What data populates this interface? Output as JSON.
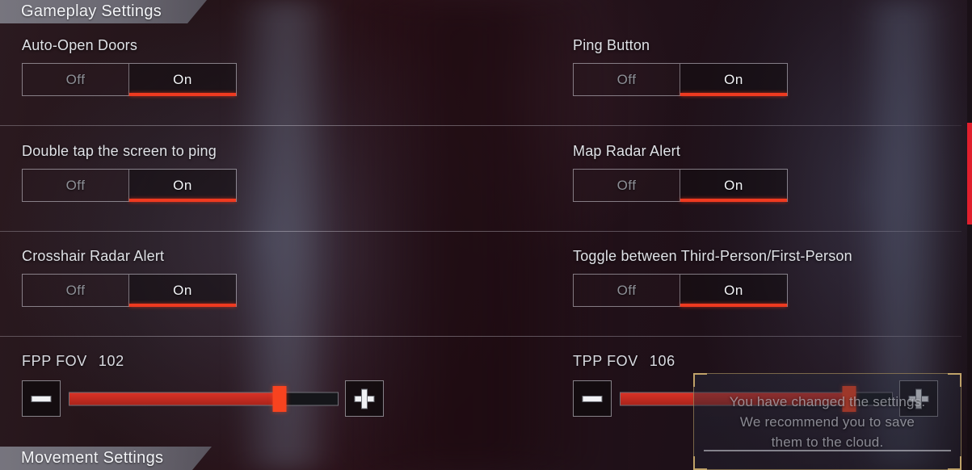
{
  "sections": {
    "gameplay": "Gameplay Settings",
    "movement": "Movement Settings"
  },
  "toggle_options": {
    "off": "Off",
    "on": "On"
  },
  "settings": [
    {
      "label": "Auto-Open Doors",
      "value": "On",
      "column": "left",
      "row": 1
    },
    {
      "label": "Ping Button",
      "value": "On",
      "column": "right",
      "row": 1
    },
    {
      "label": "Double tap the screen to ping",
      "value": "On",
      "column": "left",
      "row": 2
    },
    {
      "label": "Map Radar Alert",
      "value": "On",
      "column": "right",
      "row": 2
    },
    {
      "label": "Crosshair Radar Alert",
      "value": "On",
      "column": "left",
      "row": 3
    },
    {
      "label": "Toggle between Third-Person/First-Person",
      "value": "On",
      "column": "right",
      "row": 3
    }
  ],
  "sliders": [
    {
      "name": "FPP FOV",
      "value": "102",
      "percent": 78,
      "decrease_icon": "minus-icon",
      "increase_icon": "plus-icon"
    },
    {
      "name": "TPP FOV",
      "value": "106",
      "percent": 84,
      "decrease_icon": "minus-icon",
      "increase_icon": "plus-icon"
    }
  ],
  "toast": {
    "line1": "You have changed the settings.",
    "line2": "We recommend you to save",
    "line3": "them to the cloud."
  },
  "colors": {
    "accent_red": "#ef3a20",
    "slider_fill": "#c02a20",
    "slider_thumb": "#f8431f",
    "scrollbar": "#e01f2d",
    "toast_border": "#c6a86c",
    "label_text": "#dfe1e6",
    "muted_text": "#8d8f96"
  }
}
